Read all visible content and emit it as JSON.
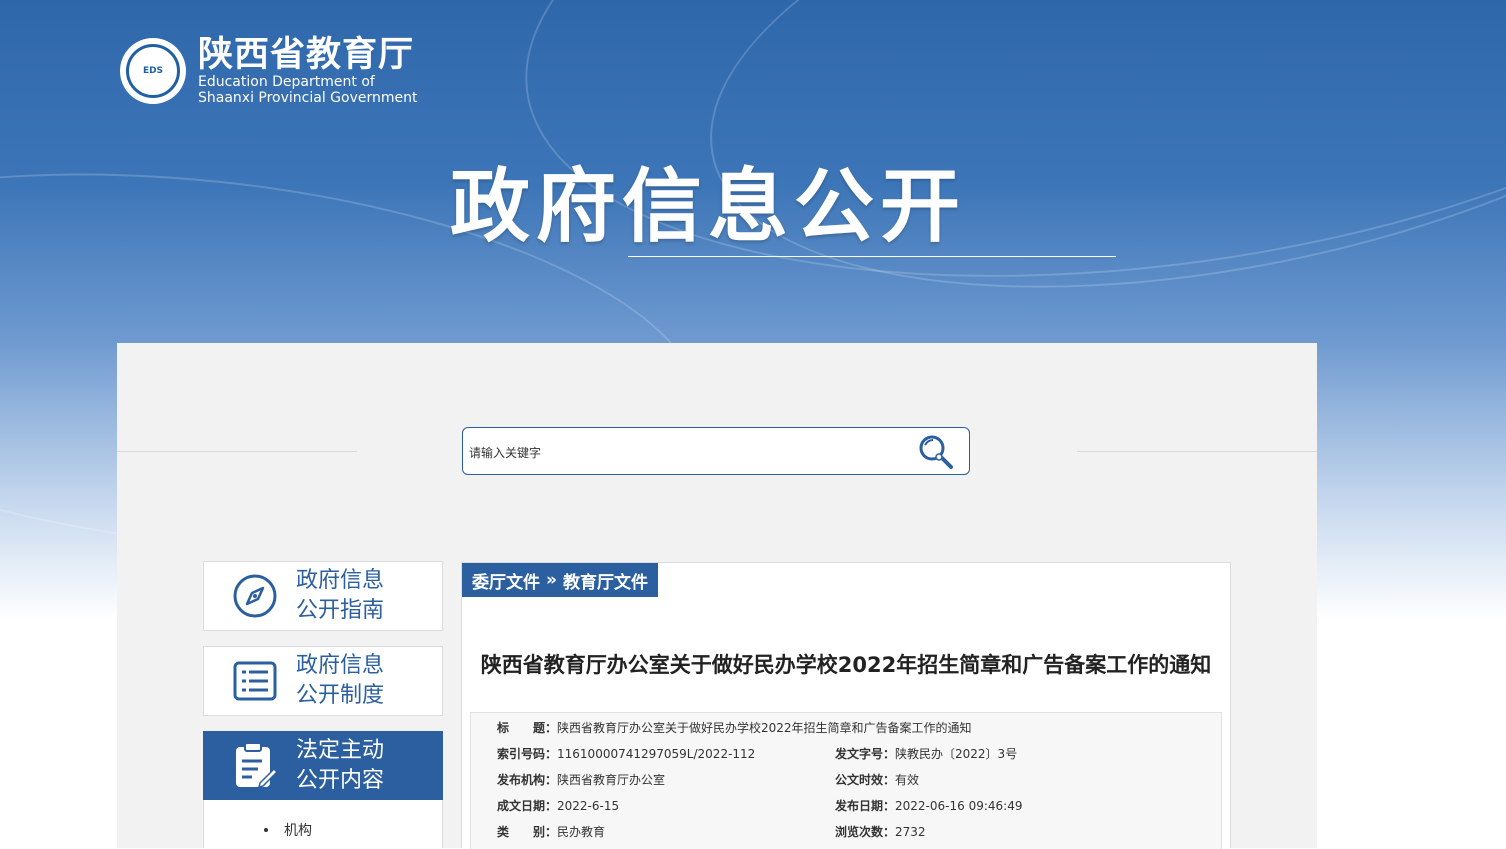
{
  "header": {
    "org_cn": "陕西省教育厅",
    "org_en_line1": "Education Department of",
    "org_en_line2": "Shaanxi Provincial Government",
    "seal_text": "EDS",
    "banner_title": "政府信息公开"
  },
  "search": {
    "placeholder": "请输入关键字",
    "icon": "search-icon"
  },
  "sidebar": {
    "items": [
      {
        "label": "政府信息\n公开指南",
        "icon": "compass-icon",
        "active": false
      },
      {
        "label": "政府信息\n公开制度",
        "icon": "list-icon",
        "active": false
      },
      {
        "label": "法定主动\n公开内容",
        "icon": "clipboard-edit-icon",
        "active": true
      }
    ],
    "sub_items": [
      "机构"
    ]
  },
  "breadcrumb": {
    "level1": "委厅文件",
    "separator": "»",
    "level2": "教育厅文件"
  },
  "document": {
    "title": "陕西省教育厅办公室关于做好民办学校2022年招生简章和广告备案工作的通知",
    "meta": {
      "title_key": "标　　题：",
      "title_val": "陕西省教育厅办公室关于做好民办学校2022年招生简章和广告备案工作的通知",
      "index_key": "索引号码：",
      "index_val": "11610000741297059L/2022-112",
      "docno_key": "发文字号：",
      "docno_val": "陕教民办〔2022〕3号",
      "org_key": "发布机构：",
      "org_val": "陕西省教育厅办公室",
      "validity_key": "公文时效：",
      "validity_val": "有效",
      "created_key": "成文日期：",
      "created_val": "2022-6-15",
      "published_key": "发布日期：",
      "published_val": "2022-06-16 09:46:49",
      "category_key": "类　　别：",
      "category_val": "民办教育",
      "views_key": "浏览次数：",
      "views_val": "2732"
    }
  },
  "colors": {
    "brand_blue": "#2b5f9f",
    "panel_bg": "#f2f2f2"
  }
}
